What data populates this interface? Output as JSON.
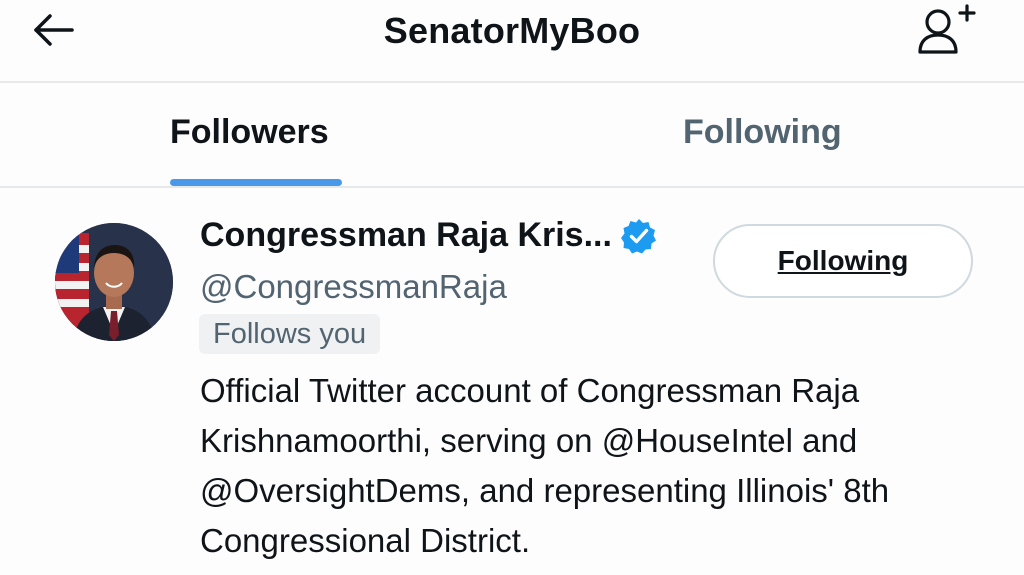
{
  "header": {
    "title": "SenatorMyBoo",
    "back_icon": "arrow-left-icon",
    "add_icon": "person-add-icon"
  },
  "tabs": [
    {
      "label": "Followers",
      "active": true
    },
    {
      "label": "Following",
      "active": false
    }
  ],
  "user": {
    "display_name": "Congressman Raja Kris...",
    "verified": true,
    "handle": "@CongressmanRaja",
    "follows_you_label": "Follows you",
    "button_label": "Following",
    "bio": "Official Twitter account of Congressman Raja Krishnamoorthi, serving on @HouseIntel and @OversightDems, and representing Illinois' 8th Congressional District."
  },
  "colors": {
    "accent": "#4a99e9",
    "verified": "#1d9bf0",
    "secondary_text": "#536471",
    "primary_text": "#0f1419"
  }
}
